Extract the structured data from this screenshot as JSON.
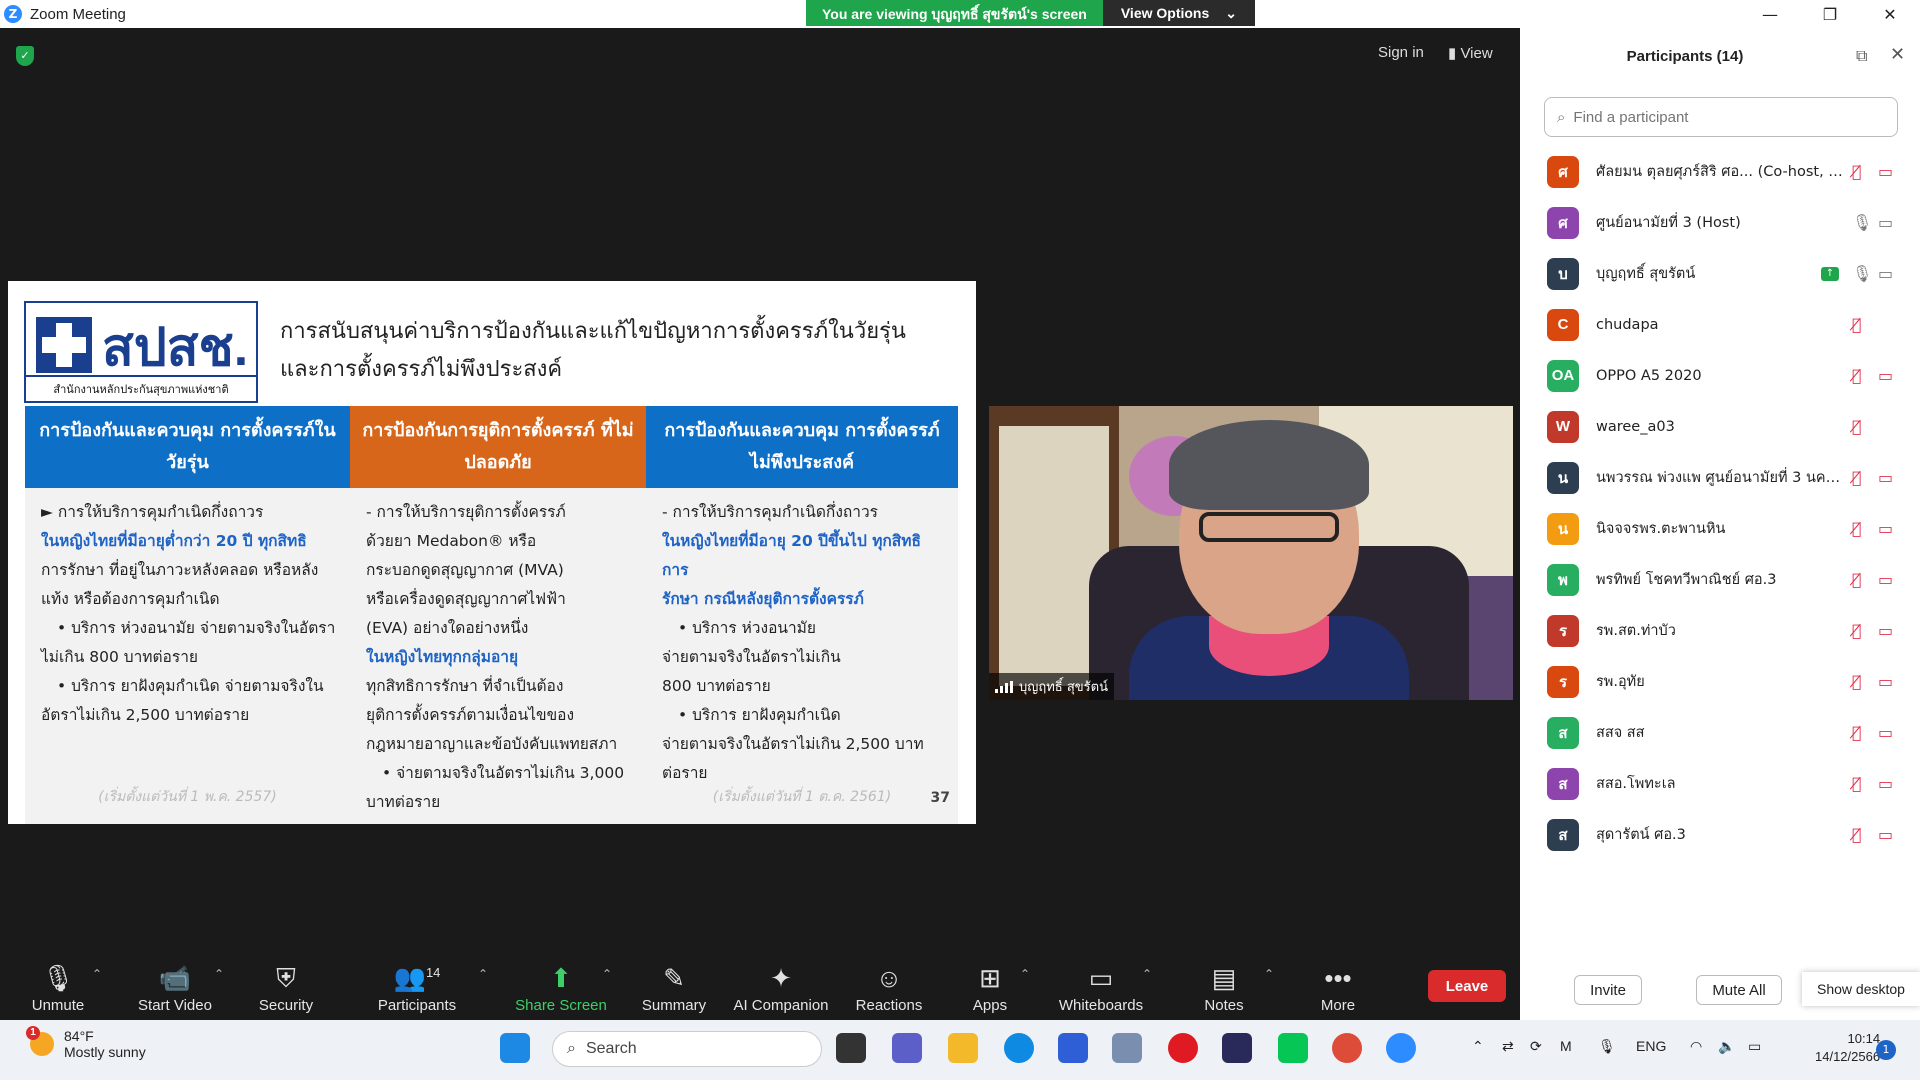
{
  "window": {
    "title": "Zoom Meeting",
    "banner_text": "You are viewing บุญฤทธิ์ สุขรัตน์'s screen",
    "view_options": "View Options"
  },
  "top_right": {
    "sign_in": "Sign in",
    "view": "View"
  },
  "slide": {
    "logo_text": "สปสช.",
    "logo_sub": "สำนักงานหลักประกันสุขภาพแห่งชาติ",
    "title_line1": "การสนับสนุนค่าบริการป้องกันและแก้ไขปัญหาการตั้งครรภ์ในวัยรุ่น",
    "title_line2": "และการตั้งครรภ์ไม่พึงประสงค์",
    "page_number": "37",
    "columns": [
      {
        "header": "การป้องกันและควบคุม การตั้งครรภ์ในวัยรุ่น",
        "color": "#0e6fc7",
        "lines": [
          {
            "text": "► การให้บริการคุมกำเนิดกึ่งถาวร",
            "style": "normal"
          },
          {
            "text": "ในหญิงไทยที่มีอายุต่ำกว่า 20 ปี ทุกสิทธิ",
            "style": "hl"
          },
          {
            "text": "การรักษา ที่อยู่ในภาวะหลังคลอด หรือหลัง",
            "style": "normal"
          },
          {
            "text": "แท้ง หรือต้องการคุมกำเนิด",
            "style": "normal"
          },
          {
            "text": "• บริการ ห่วงอนามัย จ่ายตามจริงในอัตรา",
            "style": "bullet"
          },
          {
            "text": "ไม่เกิน 800 บาทต่อราย",
            "style": "normal"
          },
          {
            "text": "• บริการ ยาฝังคุมกำเนิด จ่ายตามจริงใน",
            "style": "bullet"
          },
          {
            "text": "อัตราไม่เกิน 2,500 บาทต่อราย",
            "style": "normal"
          }
        ],
        "footer": "(เริ่มตั้งแต่วันที่ 1 พ.ค. 2557)"
      },
      {
        "header": "การป้องกันการยุติการตั้งครรภ์ ที่ไม่ปลอดภัย",
        "color": "#d7661a",
        "lines": [
          {
            "text": "- การให้บริการยุติการตั้งครรภ์",
            "style": "normal"
          },
          {
            "text": "ด้วยยา Medabon® หรือ",
            "style": "normal"
          },
          {
            "text": "กระบอกดูดสุญญากาศ (MVA)",
            "style": "normal"
          },
          {
            "text": "หรือเครื่องดูดสุญญากาศไฟฟ้า",
            "style": "normal"
          },
          {
            "text": "(EVA) อย่างใดอย่างหนึ่ง",
            "style": "normal"
          },
          {
            "text": "ในหญิงไทยทุกกลุ่มอายุ",
            "style": "hl"
          },
          {
            "text": "ทุกสิทธิการรักษา ที่จำเป็นต้อง",
            "style": "normal"
          },
          {
            "text": "ยุติการตั้งครรภ์ตามเงื่อนไขของ",
            "style": "normal"
          },
          {
            "text": "กฎหมายอาญาและข้อบังคับแพทยสภา",
            "style": "normal"
          },
          {
            "text": "• จ่ายตามจริงในอัตราไม่เกิน 3,000",
            "style": "bullet"
          },
          {
            "text": "บาทต่อราย",
            "style": "normal"
          }
        ],
        "footer": ""
      },
      {
        "header": "การป้องกันและควบคุม การตั้งครรภ์ไม่พึงประสงค์",
        "color": "#0e6fc7",
        "lines": [
          {
            "text": "- การให้บริการคุมกำเนิดกึ่งถาวร",
            "style": "normal"
          },
          {
            "text": "ในหญิงไทยที่มีอายุ 20 ปีขึ้นไป ทุกสิทธิการ",
            "style": "hl"
          },
          {
            "text": "รักษา กรณีหลังยุติการตั้งครรภ์",
            "style": "hl"
          },
          {
            "text": "• บริการ ห่วงอนามัย",
            "style": "bullet"
          },
          {
            "text": "จ่ายตามจริงในอัตราไม่เกิน",
            "style": "normal"
          },
          {
            "text": "800 บาทต่อราย",
            "style": "normal"
          },
          {
            "text": "• บริการ ยาฝังคุมกำเนิด",
            "style": "bullet"
          },
          {
            "text": "จ่ายตามจริงในอัตราไม่เกิน 2,500 บาท",
            "style": "normal"
          },
          {
            "text": "ต่อราย",
            "style": "normal"
          }
        ],
        "footer": "(เริ่มตั้งแต่วันที่ 1 ต.ค. 2561)"
      }
    ]
  },
  "video": {
    "name": "บุญฤทธิ์ สุขรัตน์"
  },
  "toolbar": {
    "unmute": "Unmute",
    "start_video": "Start Video",
    "security": "Security",
    "participants": "Participants",
    "participants_count": "14",
    "share_screen": "Share Screen",
    "summary": "Summary",
    "ai_companion": "AI Companion",
    "reactions": "Reactions",
    "apps": "Apps",
    "whiteboards": "Whiteboards",
    "notes": "Notes",
    "more": "More",
    "leave": "Leave"
  },
  "panel": {
    "title": "Participants (14)",
    "search_placeholder": "Find a participant",
    "invite": "Invite",
    "mute_all": "Mute All",
    "show_desktop": "Show desktop",
    "participants": [
      {
        "initial": "ศ",
        "name": "ศัลยมน ตุลยศุภร์สิริ ศอ... (Co-host, me)",
        "color": "#d9480f",
        "mic": "muted",
        "cam": "off",
        "sharing": false
      },
      {
        "initial": "ศ",
        "name": "ศูนย์อนามัยที่ 3 (Host)",
        "color": "#8e44ad",
        "mic": "on",
        "cam": "on",
        "sharing": false
      },
      {
        "initial": "บ",
        "name": "บุญฤทธิ์ สุขรัตน์",
        "color": "#2c3e50",
        "mic": "on",
        "cam": "on",
        "sharing": true
      },
      {
        "initial": "C",
        "name": "chudapa",
        "color": "#d9480f",
        "mic": "muted",
        "cam": "none",
        "sharing": false
      },
      {
        "initial": "OA",
        "name": "OPPO A5 2020",
        "color": "#27ae60",
        "mic": "muted",
        "cam": "off",
        "sharing": false
      },
      {
        "initial": "W",
        "name": "waree_a03",
        "color": "#c0392b",
        "mic": "muted",
        "cam": "none",
        "sharing": false
      },
      {
        "initial": "น",
        "name": "นพวรรณ พ่วงแพ ศูนย์อนามัยที่ 3 นครส...",
        "color": "#2c3e50",
        "mic": "muted",
        "cam": "off",
        "sharing": false
      },
      {
        "initial": "น",
        "name": "นิจจจรพร.ตะพานหิน",
        "color": "#f39c12",
        "mic": "muted",
        "cam": "off",
        "sharing": false
      },
      {
        "initial": "พ",
        "name": "พรทิพย์ โชคทวีพาณิชย์ ศอ.3",
        "color": "#27ae60",
        "mic": "muted",
        "cam": "off",
        "sharing": false
      },
      {
        "initial": "ร",
        "name": "รพ.สต.ท่าบัว",
        "color": "#c0392b",
        "mic": "muted",
        "cam": "off",
        "sharing": false
      },
      {
        "initial": "ร",
        "name": "รพ.อุทัย",
        "color": "#d9480f",
        "mic": "muted",
        "cam": "off",
        "sharing": false
      },
      {
        "initial": "ส",
        "name": "สสจ สส",
        "color": "#27ae60",
        "mic": "muted",
        "cam": "off",
        "sharing": false
      },
      {
        "initial": "ส",
        "name": "สสอ.โพทะเล",
        "color": "#8e44ad",
        "mic": "muted",
        "cam": "off",
        "sharing": false
      },
      {
        "initial": "ส",
        "name": "สุดารัตน์ ศอ.3",
        "color": "#2c3e50",
        "mic": "muted",
        "cam": "off",
        "sharing": false
      }
    ]
  },
  "taskbar": {
    "weather_badge": "1",
    "temperature": "84°F",
    "weather_text": "Mostly sunny",
    "search": "Search",
    "language": "ENG",
    "time": "10:14",
    "date": "14/12/2566",
    "notification_count": "1"
  }
}
